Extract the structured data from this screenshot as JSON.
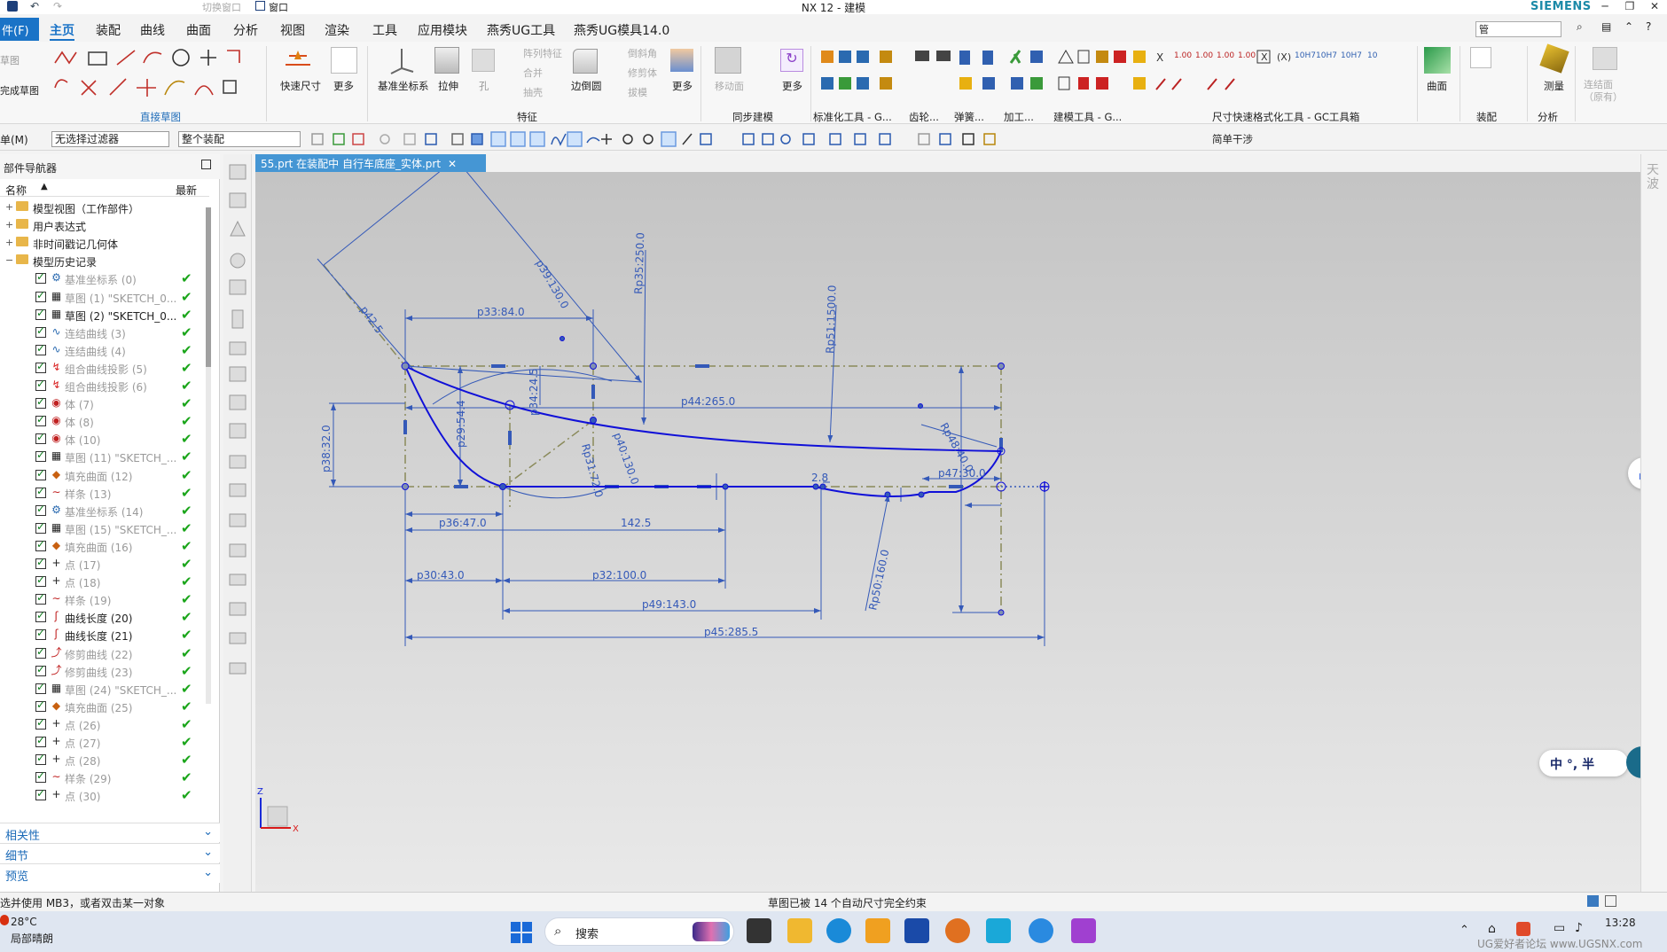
{
  "title": "NX 12 - 建模",
  "brand": "SIEMENS",
  "quick_access": {
    "switch_window": "切换窗口",
    "window_menu": "窗口"
  },
  "menubar": {
    "file": "件(F)",
    "tabs": [
      "主页",
      "装配",
      "曲线",
      "曲面",
      "分析",
      "视图",
      "渲染",
      "工具",
      "应用模块",
      "燕秀UG工具",
      "燕秀UG模具14.0"
    ],
    "search_value": "管"
  },
  "ribbon": {
    "sketch": "草图",
    "finish_sketch": "完成草图",
    "direct_sketch": "直接草图",
    "quick_dim": "快速尺寸",
    "more": "更多",
    "datum_csys": "基准坐标系",
    "extrude": "拉伸",
    "hole": "孔",
    "pattern_feature": "阵列特征",
    "unite": "合并",
    "shell": "抽壳",
    "edge_blend": "边倒圆",
    "chamfer": "倒斜角",
    "trim_body": "修剪体",
    "draft": "拔模",
    "move_face": "移动面",
    "feature_group": "特征",
    "sync_group": "同步建模",
    "std_tools": "标准化工具 - G...",
    "gear": "齿轮...",
    "spring": "弹簧...",
    "machining": "加工...",
    "modeling_tools": "建模工具 - G...",
    "dim_tools": "尺寸快速格式化工具 - GC工具箱",
    "surface": "曲面",
    "assembly": "装配",
    "analysis": "分析",
    "measure": "测量",
    "linked_face": "连结面（原有）"
  },
  "selbar": {
    "menu": "单(M)",
    "filter": "无选择过滤器",
    "scope": "整个装配",
    "simple_interference": "简单干涉"
  },
  "navigator": {
    "title": "部件导航器",
    "col_name": "名称",
    "col_latest": "最新",
    "items": [
      {
        "label": "模型视图（工作部件）",
        "muted": false,
        "top": true
      },
      {
        "label": "用户表达式",
        "muted": false,
        "top": true
      },
      {
        "label": "非时间戳记几何体",
        "muted": false,
        "top": true
      },
      {
        "label": "模型历史记录",
        "muted": false,
        "top": true
      },
      {
        "label": "基准坐标系 (0)",
        "muted": true,
        "icon": "csys-icon"
      },
      {
        "label": "草图 (1) \"SKETCH_0...",
        "muted": true,
        "icon": "sketch-icon"
      },
      {
        "label": "草图 (2) \"SKETCH_0...",
        "muted": false,
        "icon": "sketch-icon"
      },
      {
        "label": "连结曲线 (3)",
        "muted": true,
        "icon": "curve-icon"
      },
      {
        "label": "连结曲线 (4)",
        "muted": true,
        "icon": "curve-icon"
      },
      {
        "label": "组合曲线投影 (5)",
        "muted": true,
        "icon": "projection-icon"
      },
      {
        "label": "组合曲线投影 (6)",
        "muted": true,
        "icon": "projection-icon"
      },
      {
        "label": "体 (7)",
        "muted": true,
        "icon": "body-icon"
      },
      {
        "label": "体 (8)",
        "muted": true,
        "icon": "body-icon"
      },
      {
        "label": "体 (10)",
        "muted": true,
        "icon": "body-icon"
      },
      {
        "label": "草图 (11) \"SKETCH_...",
        "muted": true,
        "icon": "sketch-icon"
      },
      {
        "label": "填充曲面 (12)",
        "muted": true,
        "icon": "fill-surface-icon"
      },
      {
        "label": "样条 (13)",
        "muted": true,
        "icon": "spline-icon"
      },
      {
        "label": "基准坐标系 (14)",
        "muted": true,
        "icon": "csys-icon"
      },
      {
        "label": "草图 (15) \"SKETCH_...",
        "muted": true,
        "icon": "sketch-icon"
      },
      {
        "label": "填充曲面 (16)",
        "muted": true,
        "icon": "fill-surface-icon"
      },
      {
        "label": "点 (17)",
        "muted": true,
        "icon": "point-icon"
      },
      {
        "label": "点 (18)",
        "muted": true,
        "icon": "point-icon"
      },
      {
        "label": "样条 (19)",
        "muted": true,
        "icon": "spline-icon"
      },
      {
        "label": "曲线长度 (20)",
        "muted": false,
        "icon": "curve-length-icon"
      },
      {
        "label": "曲线长度 (21)",
        "muted": false,
        "icon": "curve-length-icon"
      },
      {
        "label": "修剪曲线 (22)",
        "muted": true,
        "icon": "trim-curve-icon"
      },
      {
        "label": "修剪曲线 (23)",
        "muted": true,
        "icon": "trim-curve-icon"
      },
      {
        "label": "草图 (24) \"SKETCH_...",
        "muted": true,
        "icon": "sketch-icon"
      },
      {
        "label": "填充曲面 (25)",
        "muted": true,
        "icon": "fill-surface-icon"
      },
      {
        "label": "点 (26)",
        "muted": true,
        "icon": "point-icon"
      },
      {
        "label": "点 (27)",
        "muted": true,
        "icon": "point-icon"
      },
      {
        "label": "点 (28)",
        "muted": true,
        "icon": "point-icon"
      },
      {
        "label": "样条 (29)",
        "muted": true,
        "icon": "spline-icon"
      },
      {
        "label": "点 (30)",
        "muted": true,
        "icon": "point-icon"
      }
    ],
    "panels": [
      "相关性",
      "细节",
      "预览"
    ]
  },
  "document_tab": "55.prt 在装配中 自行车底座_实体.prt",
  "dimensions": {
    "p39": "p39:130.0",
    "r35": "Rp35:250.0",
    "p42": "p42.5",
    "p33": "p33:84.0",
    "r51": "Rp51:1500.0",
    "p34": "p34:24.5",
    "p44": "p44:265.0",
    "p29": "p29:54.4",
    "p38": "p38:32.0",
    "p40": "p40:130.0",
    "r31": "Rp31:72.0",
    "r48": "Rp48:40.0",
    "d28": "2.8",
    "p47": "p47:30.0",
    "p36": "p36:47.0",
    "d142": "142.5",
    "p30": "p30:43.0",
    "p32": "p32:100.0",
    "p49": "p49:143.0",
    "r50": "Rp50:160.0",
    "p45": "p45:285.5",
    "axis_x": "X",
    "axis_z": "Z"
  },
  "ime": {
    "label": "中 °, 半"
  },
  "status": {
    "left": "选并使用 MB3，或者双击某一对象",
    "center": "草图已被 14 个自动尺寸完全约束"
  },
  "taskbar": {
    "temp": "28°C",
    "weather": "局部晴朗",
    "search": "搜索",
    "time": "13:28",
    "watermark": "UG爱好者论坛 www.UGSNX.com"
  }
}
